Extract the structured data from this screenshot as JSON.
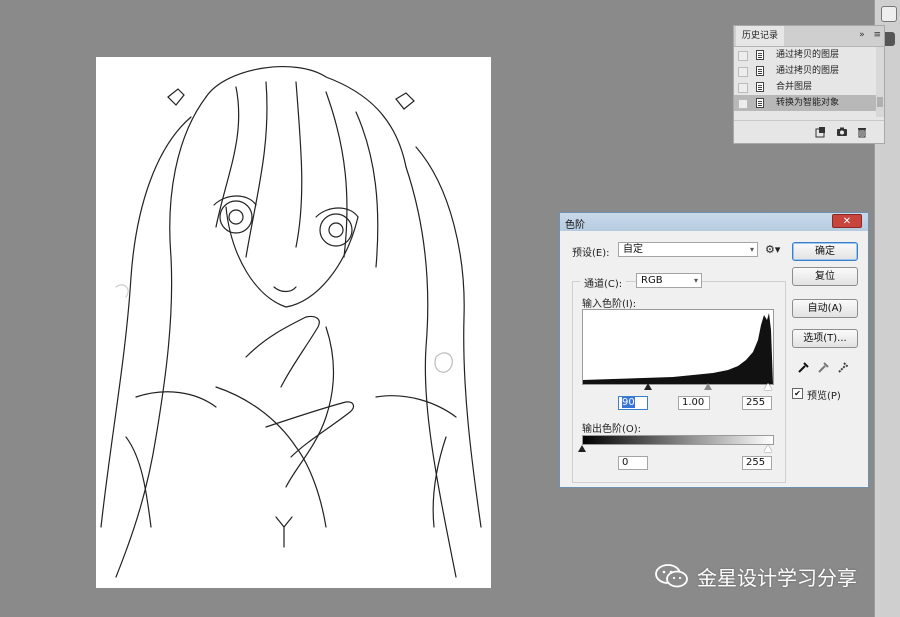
{
  "history_panel": {
    "tab_label": "历史记录",
    "expand_icon": "double-chevron-right-icon",
    "menu_icon": "hamburger-menu-icon",
    "items": [
      {
        "label": "通过拷贝的图层",
        "selected": false
      },
      {
        "label": "通过拷贝的图层",
        "selected": false
      },
      {
        "label": "合并图层",
        "selected": false
      },
      {
        "label": "转换为智能对象",
        "selected": true
      }
    ],
    "bottom_icons": [
      "new-document-from-state-icon",
      "camera-snapshot-icon",
      "trash-icon"
    ]
  },
  "levels_dialog": {
    "title": "色阶",
    "preset_label": "预设(E):",
    "preset_value": "自定",
    "channel_label": "通道(C):",
    "channel_value": "RGB",
    "input_levels_label": "输入色阶(I):",
    "input_black": "90",
    "input_gamma": "1.00",
    "input_white": "255",
    "output_levels_label": "输出色阶(O):",
    "output_black": "0",
    "output_white": "255",
    "buttons": {
      "ok": "确定",
      "reset": "复位",
      "auto": "自动(A)",
      "options": "选项(T)..."
    },
    "preview_label": "预览(P)",
    "preview_checked": true,
    "histogram_shape": "low flat tail rising sharply at the right end",
    "close_glyph": "✕"
  },
  "watermark": {
    "text": "金星设计学习分享",
    "icon": "wechat-icon"
  },
  "canvas": {
    "content": "line-art sketch of a girl"
  },
  "colors": {
    "workspace_bg": "#8a8a8a",
    "dialog_title_bg": "#c9d9ea",
    "close_button": "#c8453d",
    "selection": "#3875d7"
  }
}
